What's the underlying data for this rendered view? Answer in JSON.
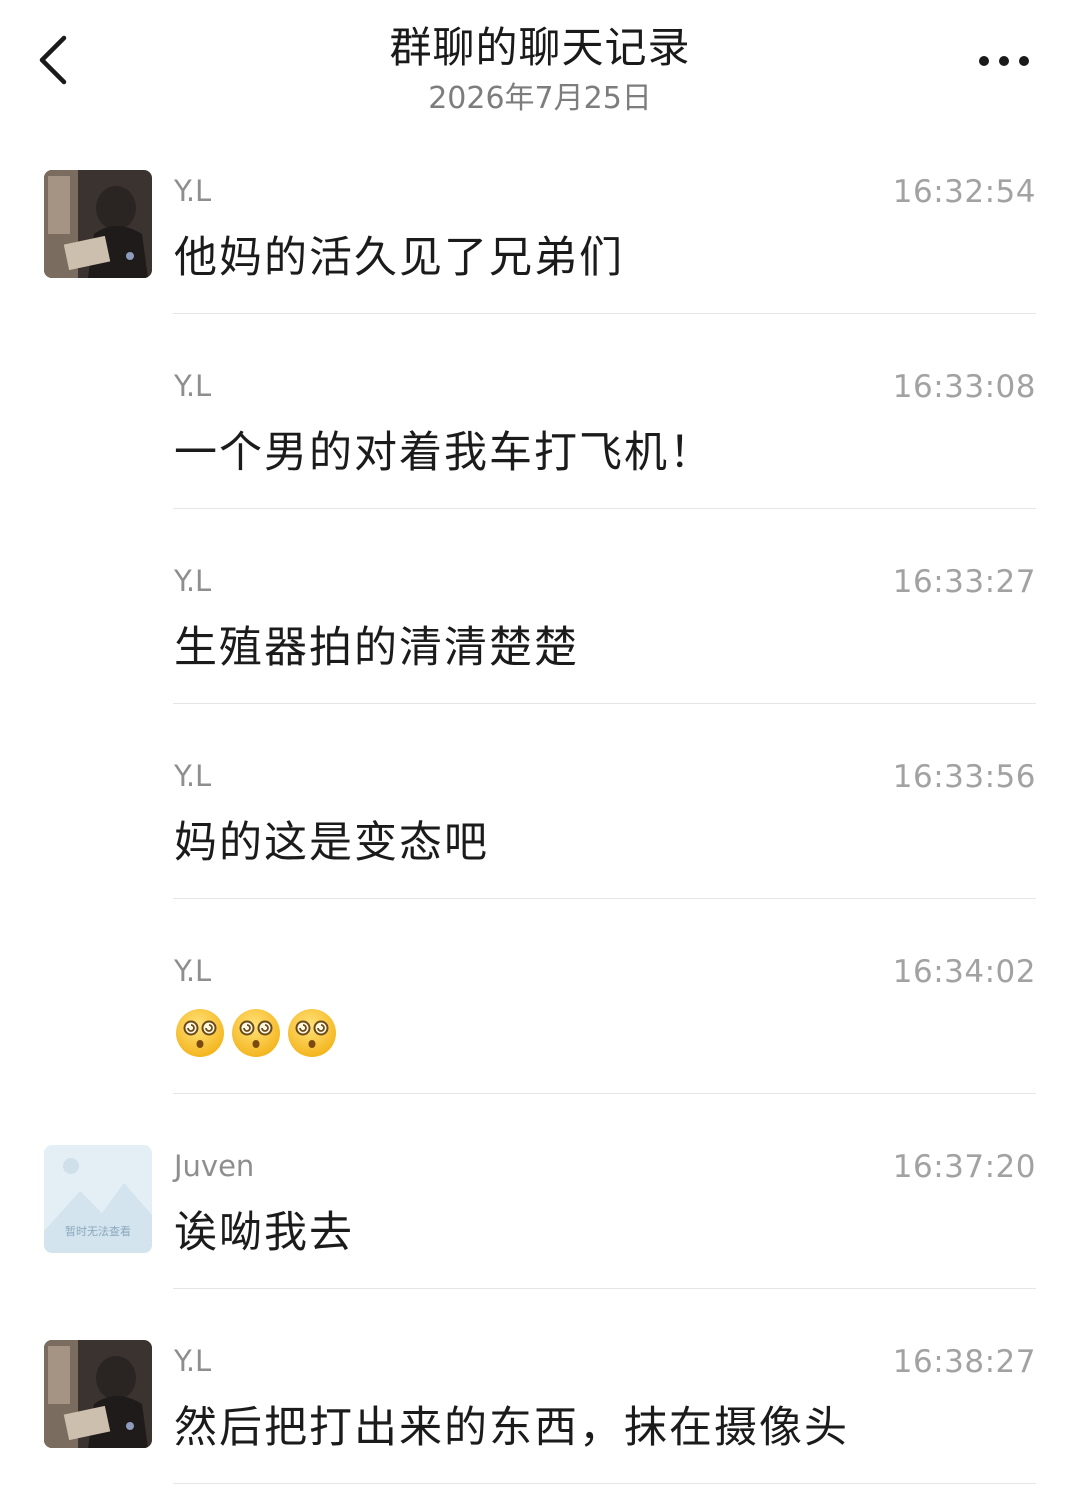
{
  "header": {
    "title": "群聊的聊天记录",
    "date": "2026年7月25日",
    "back_icon": "chevron-left-icon",
    "more_icon": "more-dots-icon"
  },
  "messages": [
    {
      "sender": "Y.L",
      "time": "16:32:54",
      "text": "他妈的活久见了兄弟们",
      "avatar": "photo"
    },
    {
      "sender": "Y.L",
      "time": "16:33:08",
      "text": "一个男的对着我车打飞机！"
    },
    {
      "sender": "Y.L",
      "time": "16:33:27",
      "text": "生殖器拍的清清楚楚"
    },
    {
      "sender": "Y.L",
      "time": "16:33:56",
      "text": "妈的这是变态吧"
    },
    {
      "sender": "Y.L",
      "time": "16:34:02",
      "emojis": [
        "dizzy-face-icon",
        "dizzy-face-icon",
        "dizzy-face-icon"
      ]
    },
    {
      "sender": "Juven",
      "time": "16:37:20",
      "text": "诶呦我去",
      "avatar": "placeholder",
      "avatar_caption": "暂时无法查看"
    },
    {
      "sender": "Y.L",
      "time": "16:38:27",
      "text": "然后把打出来的东西，抹在摄像头",
      "avatar": "photo"
    }
  ],
  "colors": {
    "title": "#1a1a1a",
    "secondary": "#8e8e8e",
    "timestamp": "#a2a2a2",
    "divider": "#e6e6e6",
    "placeholder_avatar": "#e4eff5"
  }
}
